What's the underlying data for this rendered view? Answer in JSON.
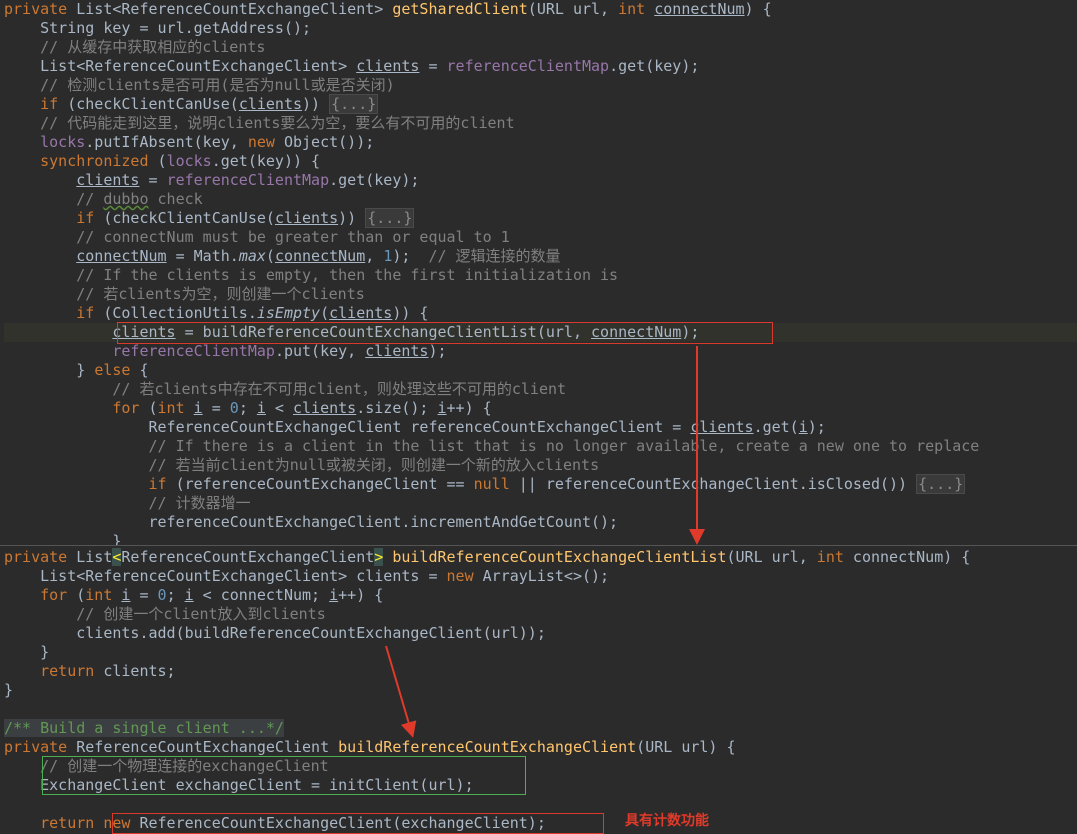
{
  "editor": {
    "top_lines": [
      [
        [
          "kw",
          "private "
        ],
        [
          "p",
          "List<ReferenceCountExchangeClient> "
        ],
        [
          "fn",
          "getSharedClient"
        ],
        [
          "p",
          "(URL url, "
        ],
        [
          "kw",
          "int "
        ],
        [
          "var",
          "connectNum"
        ],
        [
          "p",
          ") {"
        ]
      ],
      [
        [
          "p",
          "    String key = url.getAddress();"
        ]
      ],
      [
        [
          "cmt",
          "    // 从缓存中获取相应的clients"
        ]
      ],
      [
        [
          "p",
          "    List<ReferenceCountExchangeClient> "
        ],
        [
          "var",
          "clients"
        ],
        [
          "p",
          " = "
        ],
        [
          "fld",
          "referenceClientMap"
        ],
        [
          "p",
          ".get(key);"
        ]
      ],
      [
        [
          "cmt",
          "    // 检测clients是否可用(是否为null或是否关闭)"
        ]
      ],
      [
        [
          "kw",
          "    if "
        ],
        [
          "p",
          "(checkClientCanUse("
        ],
        [
          "var",
          "clients"
        ],
        [
          "p",
          ")) "
        ],
        [
          "fold",
          "{...}"
        ]
      ],
      [
        [
          "cmt",
          "    // 代码能走到这里，说明clients要么为空，要么有不可用的client"
        ]
      ],
      [
        [
          "fld",
          "    locks"
        ],
        [
          "p",
          ".putIfAbsent(key, "
        ],
        [
          "kw",
          "new "
        ],
        [
          "p",
          "Object());"
        ]
      ],
      [
        [
          "kw",
          "    synchronized "
        ],
        [
          "p",
          "("
        ],
        [
          "fld",
          "locks"
        ],
        [
          "p",
          ".get(key)) {"
        ]
      ],
      [
        [
          "p",
          "        "
        ],
        [
          "var",
          "clients"
        ],
        [
          "p",
          " = "
        ],
        [
          "fld",
          "referenceClientMap"
        ],
        [
          "p",
          ".get(key);"
        ]
      ],
      [
        [
          "cmt",
          "        // "
        ],
        [
          "cmtsq",
          "dubbo"
        ],
        [
          "cmt",
          " check"
        ]
      ],
      [
        [
          "kw",
          "        if "
        ],
        [
          "p",
          "(checkClientCanUse("
        ],
        [
          "var",
          "clients"
        ],
        [
          "p",
          ")) "
        ],
        [
          "fold",
          "{...}"
        ]
      ],
      [
        [
          "cmt",
          "        // connectNum must be greater than or equal to 1"
        ]
      ],
      [
        [
          "p",
          "        "
        ],
        [
          "var",
          "connectNum"
        ],
        [
          "p",
          " = Math."
        ],
        [
          "st",
          "max"
        ],
        [
          "p",
          "("
        ],
        [
          "var",
          "connectNum"
        ],
        [
          "p",
          ", "
        ],
        [
          "num",
          "1"
        ],
        [
          "p",
          ");  "
        ],
        [
          "cmt",
          "// 逻辑连接的数量"
        ]
      ],
      [
        [
          "cmt",
          "        // If the clients is empty, then the first initialization is"
        ]
      ],
      [
        [
          "cmt",
          "        // 若clients为空，则创建一个clients"
        ]
      ],
      [
        [
          "kw",
          "        if "
        ],
        [
          "p",
          "(CollectionUtils."
        ],
        [
          "st",
          "isEmpty"
        ],
        [
          "p",
          "("
        ],
        [
          "var",
          "clients"
        ],
        [
          "p",
          ")) {"
        ]
      ],
      [
        [
          "p",
          "            "
        ],
        [
          "var",
          "clients"
        ],
        [
          "p",
          " = buildReferenceCountExchangeClientList(url, "
        ],
        [
          "var",
          "connectNum"
        ],
        [
          "p",
          ");"
        ]
      ],
      [
        [
          "p",
          "            "
        ],
        [
          "fld",
          "referenceClientMap"
        ],
        [
          "p",
          ".put(key, "
        ],
        [
          "var",
          "clients"
        ],
        [
          "p",
          ");"
        ]
      ],
      [
        [
          "p",
          "        } "
        ],
        [
          "kw",
          "else "
        ],
        [
          "p",
          "{"
        ]
      ],
      [
        [
          "cmt",
          "            // 若clients中存在不可用client，则处理这些不可用的client"
        ]
      ],
      [
        [
          "kw",
          "            for "
        ],
        [
          "p",
          "("
        ],
        [
          "kw",
          "int "
        ],
        [
          "var",
          "i"
        ],
        [
          "p",
          " = "
        ],
        [
          "num",
          "0"
        ],
        [
          "p",
          "; "
        ],
        [
          "var",
          "i"
        ],
        [
          "p",
          " < "
        ],
        [
          "var",
          "clients"
        ],
        [
          "p",
          ".size(); "
        ],
        [
          "var",
          "i"
        ],
        [
          "p",
          "++) {"
        ]
      ],
      [
        [
          "p",
          "                ReferenceCountExchangeClient referenceCountExchangeClient = "
        ],
        [
          "var",
          "clients"
        ],
        [
          "p",
          ".get("
        ],
        [
          "var",
          "i"
        ],
        [
          "p",
          ");"
        ]
      ],
      [
        [
          "cmt",
          "                // If there is a client in the list that is no longer available, create a new one to replace"
        ]
      ],
      [
        [
          "cmt",
          "                // 若当前client为null或被关闭，则创建一个新的放入clients"
        ]
      ],
      [
        [
          "kw",
          "                if "
        ],
        [
          "p",
          "(referenceCountExchangeClient == "
        ],
        [
          "kw",
          "null "
        ],
        [
          "p",
          "|| referenceCountExchangeClient.isClosed()) "
        ],
        [
          "fold",
          "{...}"
        ]
      ],
      [
        [
          "cmt",
          "                // 计数器增一"
        ]
      ],
      [
        [
          "p",
          "                referenceCountExchangeClient.incrementAndGetCount();"
        ]
      ],
      [
        [
          "p",
          "            }"
        ]
      ]
    ],
    "bottom_lines": [
      [
        [
          "kw",
          "private "
        ],
        [
          "p",
          "List"
        ],
        [
          "bh",
          "<"
        ],
        [
          "p",
          "ReferenceCountExchangeClient"
        ],
        [
          "bh",
          ">"
        ],
        [
          "p",
          " "
        ],
        [
          "fn",
          "buildReferenceCountExchangeClientList"
        ],
        [
          "p",
          "(URL url, "
        ],
        [
          "kw",
          "int "
        ],
        [
          "p",
          "connectNum) {"
        ]
      ],
      [
        [
          "p",
          "    List<ReferenceCountExchangeClient> clients = "
        ],
        [
          "kw",
          "new "
        ],
        [
          "p",
          "ArrayList<>();"
        ]
      ],
      [
        [
          "kw",
          "    for "
        ],
        [
          "p",
          "("
        ],
        [
          "kw",
          "int "
        ],
        [
          "var",
          "i"
        ],
        [
          "p",
          " = "
        ],
        [
          "num",
          "0"
        ],
        [
          "p",
          "; "
        ],
        [
          "var",
          "i"
        ],
        [
          "p",
          " < connectNum; "
        ],
        [
          "var",
          "i"
        ],
        [
          "p",
          "++) {"
        ]
      ],
      [
        [
          "cmt",
          "        // 创建一个client放入到clients"
        ]
      ],
      [
        [
          "p",
          "        clients.add(buildReferenceCountExchangeClient(url));"
        ]
      ],
      [
        [
          "p",
          "    }"
        ]
      ],
      [
        [
          "kw",
          "    return "
        ],
        [
          "p",
          "clients;"
        ]
      ],
      [
        [
          "p",
          "}"
        ]
      ],
      [
        [
          "p",
          ""
        ]
      ],
      [
        [
          "doc",
          "/** Build a single client ...*/"
        ]
      ],
      [
        [
          "kw",
          "private "
        ],
        [
          "p",
          "ReferenceCountExchangeClient "
        ],
        [
          "fn",
          "buildReferenceCountExchangeClient"
        ],
        [
          "p",
          "(URL url) {"
        ]
      ],
      [
        [
          "cmt",
          "    // 创建一个物理连接的exchangeClient"
        ]
      ],
      [
        [
          "p",
          "    ExchangeClient exchangeClient = initClient(url);"
        ]
      ],
      [
        [
          "p",
          ""
        ]
      ],
      [
        [
          "kw",
          "    return "
        ],
        [
          "kw",
          "new "
        ],
        [
          "p",
          "ReferenceCountExchangeClient(exchangeClient);"
        ]
      ]
    ]
  },
  "annotation": {
    "note": "具有计数功能",
    "color_red": "#d93a2b",
    "color_green": "#4caf50"
  }
}
